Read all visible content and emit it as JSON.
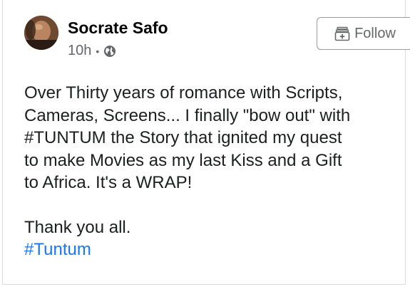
{
  "post": {
    "author": "Socrate Safo",
    "time": "10h",
    "separator": "•",
    "visibility_icon": "globe-icon",
    "follow_label": "Follow",
    "follow_icon": "follow-plus-icon",
    "lines": [
      "Over Thirty years of romance with Scripts,",
      "Cameras, Screens... I finally \"bow out\" with",
      "#TUNTUM the Story that ignited my quest",
      "to make Movies as my last Kiss and a Gift",
      "to Africa.  It's a WRAP!"
    ],
    "thanks": "Thank you all.",
    "hashtag": "#Tuntum"
  },
  "colors": {
    "link": "#1877f2",
    "meta": "#65676b",
    "text": "#1c1e21"
  }
}
